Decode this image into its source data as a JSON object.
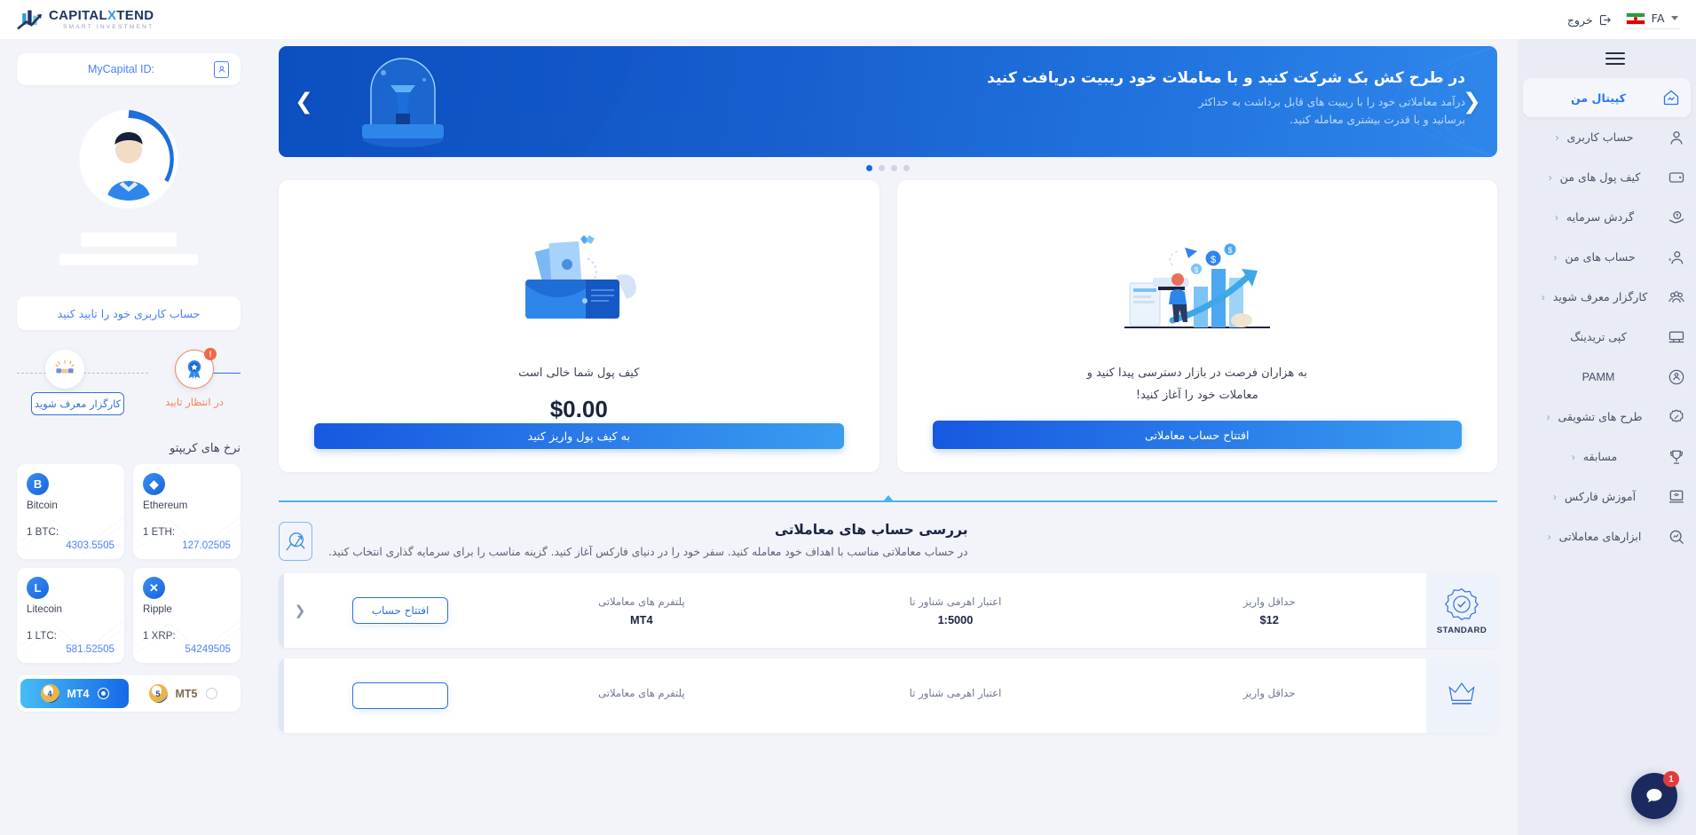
{
  "topbar": {
    "logout_label": "خروج",
    "lang_code": "FA",
    "flag_name": "iran-flag"
  },
  "logo": {
    "main_left": "CAPITAL",
    "main_x": "X",
    "main_right": "TEND",
    "sub": "SMART INVESTMENT"
  },
  "rightnav": {
    "items": [
      {
        "label": "کپیتال من",
        "icon": "home-chart-icon",
        "active": true,
        "chevron": ""
      },
      {
        "label": "حساب کاربری",
        "icon": "user-icon",
        "active": false,
        "chevron": "‹"
      },
      {
        "label": "کیف پول های من",
        "icon": "wallet-icon",
        "active": false,
        "chevron": "‹"
      },
      {
        "label": "گردش سرمایه",
        "icon": "capital-flow-icon",
        "active": false,
        "chevron": "‹"
      },
      {
        "label": "حساب های من",
        "icon": "accounts-icon",
        "active": false,
        "chevron": "‹"
      },
      {
        "label": "کارگزار معرف شوید",
        "icon": "partners-icon",
        "active": false,
        "chevron": "‹"
      },
      {
        "label": "کپی تریدینگ",
        "icon": "copy-trading-icon",
        "active": false,
        "chevron": ""
      },
      {
        "label": "PAMM",
        "icon": "pamm-icon",
        "active": false,
        "chevron": ""
      },
      {
        "label": "طرح های تشویقی",
        "icon": "promo-icon",
        "active": false,
        "chevron": "‹"
      },
      {
        "label": "مسابقه",
        "icon": "trophy-icon",
        "active": false,
        "chevron": "‹"
      },
      {
        "label": "آموزش فارکس",
        "icon": "education-icon",
        "active": false,
        "chevron": "‹"
      },
      {
        "label": "ابزارهای معاملاتی",
        "icon": "tools-icon",
        "active": false,
        "chevron": "‹"
      }
    ]
  },
  "leftpanel": {
    "id_card_label": "MyCapital ID:",
    "verify_button": "حساب کاربری خود را تایید کنید",
    "steps": {
      "referral_button": "کارگزار معرف شوید",
      "verify_caption": "در انتظار تایید",
      "verify_badge": "!"
    },
    "crypto_title": "نرخ های کریپتو",
    "crypto": [
      {
        "name": "Bitcoin",
        "symbol": "B",
        "pair": "1 BTC:",
        "price": "4303.5505"
      },
      {
        "name": "Ethereum",
        "symbol": "◆",
        "pair": "1 ETH:",
        "price": "127.02505"
      },
      {
        "name": "Litecoin",
        "symbol": "L",
        "pair": "1 LTC:",
        "price": "581.52505"
      },
      {
        "name": "Ripple",
        "symbol": "✕",
        "pair": "1 XRP:",
        "price": "54249505"
      }
    ],
    "mt_toggle": {
      "mt4_label": "MT4",
      "mt4_mark": "4",
      "mt5_label": "MT5",
      "mt5_mark": "5",
      "selected": "MT4"
    }
  },
  "banner": {
    "title": "در طرح کش بک شرکت کنید و با معاملات خود ریبیت دریافت کنید",
    "subtitle_line1": "درآمد معاملاتی خود را با ریبیت های قابل برداشت به حداکثر",
    "subtitle_line2": "برسانید و با قدرت بیشتری معامله کنید.",
    "arrow_right": "❮",
    "arrow_left": "❯",
    "dots_count": 4,
    "active_dot": 3
  },
  "cards": {
    "trading": {
      "text_line1": "به هزاران فرصت در بازار دسترسی پیدا کنید و",
      "text_line2": "معاملات خود را آغاز کنید!",
      "cta": "افتتاح حساب معاملاتی"
    },
    "wallet": {
      "text": "کیف پول شما خالی است",
      "amount": "$0.00",
      "cta": "به کیف پول واریز کنید"
    }
  },
  "accounts_section": {
    "title": "بررسی حساب های معاملاتی",
    "description": "در حساب معاملاتی مناسب با اهداف خود معامله کنید. سفر خود را در دنیای فارکس آغاز کنید. گزینه مناسب را برای سرمایه گذاری انتخاب کنید.",
    "columns": {
      "min_deposit": "حداقل واریز",
      "leverage": "اعتبار اهرمی شناور تا",
      "platforms": "پلتفرم های معاملاتی"
    },
    "rows": [
      {
        "badge": "STANDARD",
        "min_deposit": "$12",
        "leverage": "1:5000",
        "platforms": "MT4",
        "open_button": "افتتاح حساب",
        "arrow": "❮"
      },
      {
        "badge": "",
        "min_deposit": "",
        "leverage": "",
        "platforms": "",
        "open_button": "",
        "arrow": ""
      }
    ]
  },
  "chat": {
    "badge": "1",
    "icon": "chat-bubble-icon"
  }
}
